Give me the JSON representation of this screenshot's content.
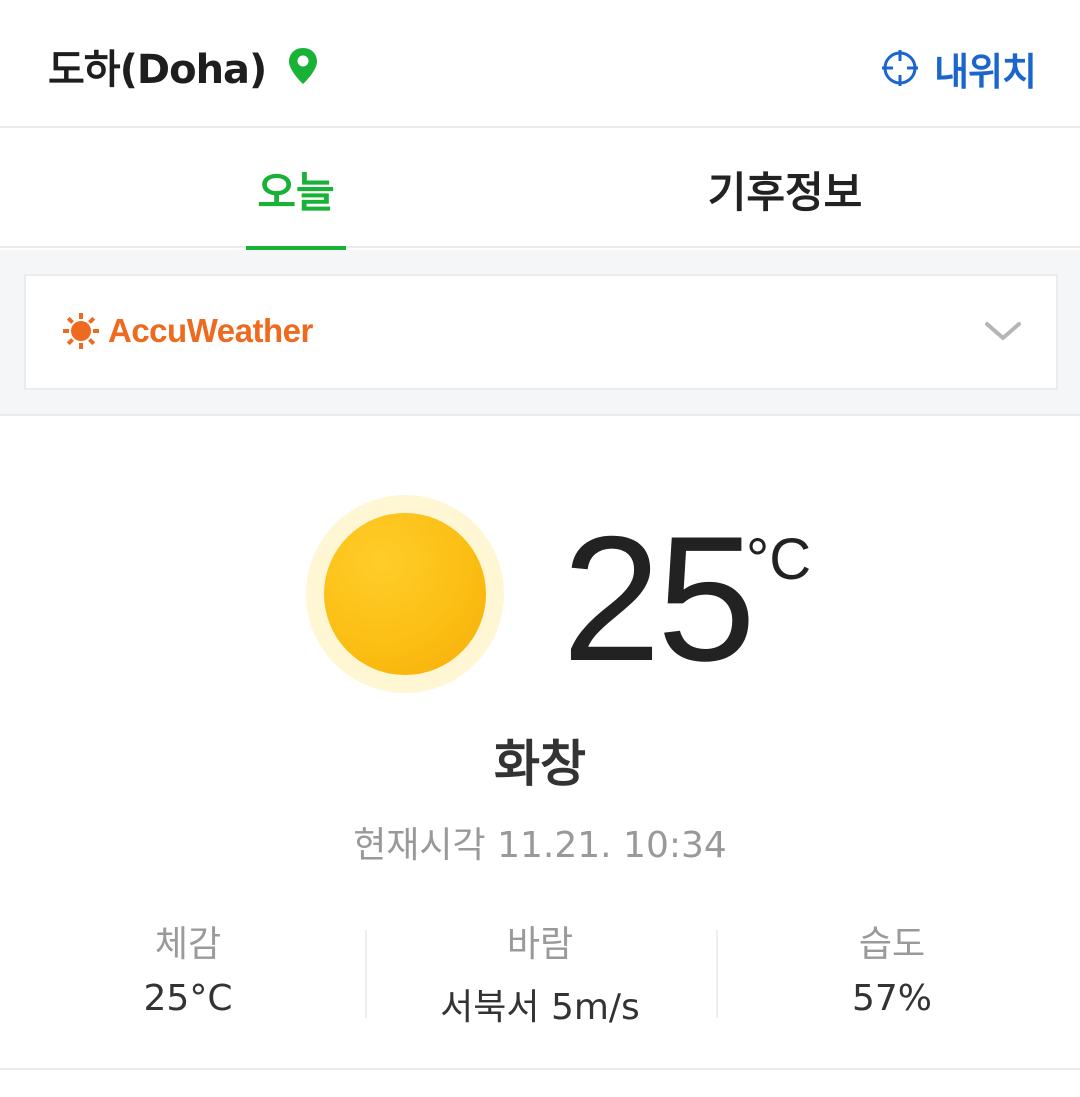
{
  "header": {
    "city": "도하(Doha)",
    "my_location_label": "내위치"
  },
  "tabs": [
    {
      "label": "오늘",
      "active": true
    },
    {
      "label": "기후정보",
      "active": false
    }
  ],
  "provider": {
    "name": "AccuWeather"
  },
  "current": {
    "temperature": "25",
    "unit": "°C",
    "condition": "화창",
    "time": "현재시각 11.21. 10:34"
  },
  "stats": [
    {
      "label": "체감",
      "value": "25°C"
    },
    {
      "label": "바람",
      "value": "서북서 5m/s"
    },
    {
      "label": "습도",
      "value": "57%"
    }
  ],
  "colors": {
    "accent_green": "#17b236",
    "link_blue": "#1a66cc",
    "accuweather_orange": "#ee6a1f",
    "sun_yellow": "#fbbd12"
  }
}
